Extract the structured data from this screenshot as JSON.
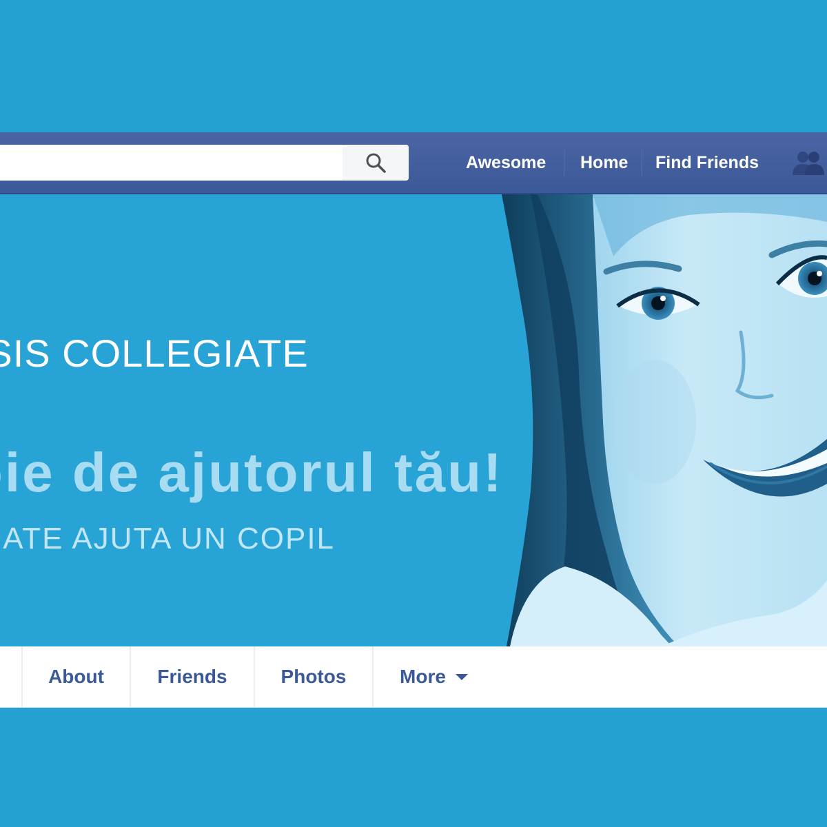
{
  "topbar": {
    "search": {
      "value": "",
      "placeholder": ""
    },
    "nav": [
      "Awesome",
      "Home",
      "Find Friends"
    ]
  },
  "cover": {
    "name": "ESIS COLLEGIATE",
    "slogan": "oie de ajutorul tău!",
    "subtitle": "OATE AJUTA UN COPIL"
  },
  "tabs": [
    "About",
    "Friends",
    "Photos",
    "More"
  ],
  "colors": {
    "background": "#24a0d1",
    "topbar": "#3b5998",
    "tab_text": "#3b5998",
    "cover": "#27a3d6"
  },
  "icons": {
    "search": "search-icon",
    "friends": "friend-requests-icon",
    "more": "caret-down-icon"
  }
}
